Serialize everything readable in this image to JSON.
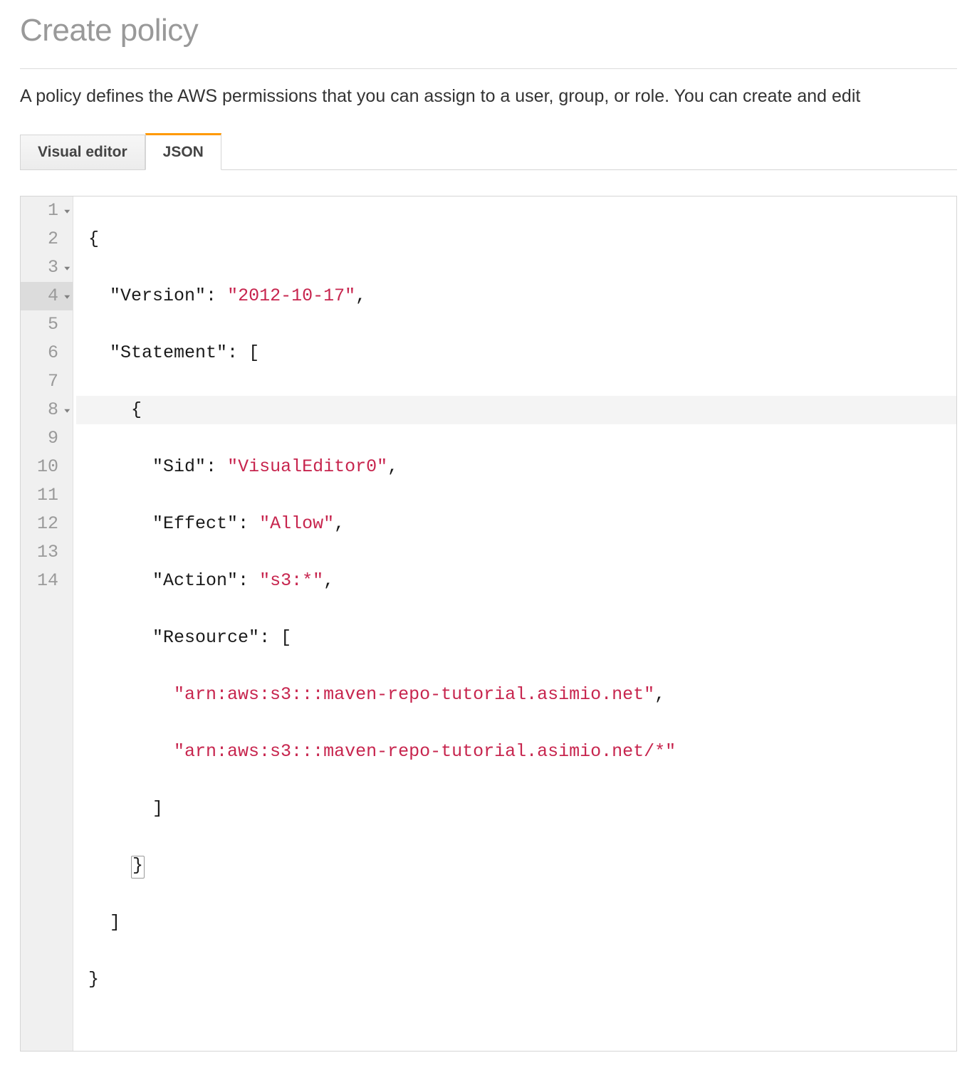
{
  "page": {
    "title": "Create policy",
    "description": "A policy defines the AWS permissions that you can assign to a user, group, or role. You can create and edit "
  },
  "tabs": {
    "visual_editor": "Visual editor",
    "json": "JSON"
  },
  "editor": {
    "gutter": {
      "l1": "1",
      "l2": "2",
      "l3": "3",
      "l4": "4",
      "l5": "5",
      "l6": "6",
      "l7": "7",
      "l8": "8",
      "l9": "9",
      "l10": "10",
      "l11": "11",
      "l12": "12",
      "l13": "13",
      "l14": "14"
    },
    "tokens": {
      "brace_open": "{",
      "brace_close": "}",
      "bracket_open": "[",
      "bracket_close": "]",
      "comma": ",",
      "colon_sp": ": ",
      "version_key": "\"Version\"",
      "version_val": "\"2012-10-17\"",
      "statement_key": "\"Statement\"",
      "sid_key": "\"Sid\"",
      "sid_val": "\"VisualEditor0\"",
      "effect_key": "\"Effect\"",
      "effect_val": "\"Allow\"",
      "action_key": "\"Action\"",
      "action_val": "\"s3:*\"",
      "resource_key": "\"Resource\"",
      "arn1": "\"arn:aws:s3:::maven-repo-tutorial.asimio.net\"",
      "arn2": "\"arn:aws:s3:::maven-repo-tutorial.asimio.net/*\""
    }
  }
}
